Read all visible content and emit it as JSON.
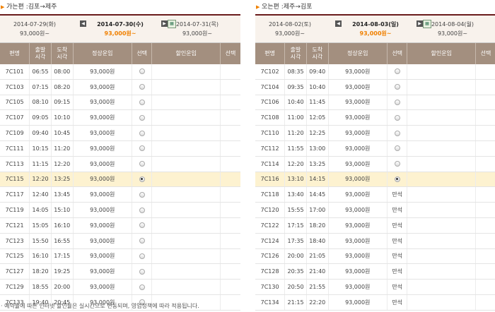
{
  "left": {
    "title": "가는편 :김포→제주",
    "dates": {
      "prev": {
        "date": "2014-07-29(화)",
        "price": "93,000원~"
      },
      "current": {
        "date": "2014-07-30(수)",
        "price": "93,000원~"
      },
      "next": {
        "date": "2014-07-31(목)",
        "price": "93,000원~"
      }
    },
    "headers": [
      "편명",
      "출발\n시각",
      "도착\n시각",
      "정상운임",
      "선택",
      "할인운임",
      "선택"
    ],
    "rows": [
      {
        "flight": "7C101",
        "dep": "06:55",
        "arr": "08:00",
        "fare": "93,000원",
        "status": "radio",
        "selected": false
      },
      {
        "flight": "7C103",
        "dep": "07:15",
        "arr": "08:20",
        "fare": "93,000원",
        "status": "radio",
        "selected": false
      },
      {
        "flight": "7C105",
        "dep": "08:10",
        "arr": "09:15",
        "fare": "93,000원",
        "status": "radio",
        "selected": false
      },
      {
        "flight": "7C107",
        "dep": "09:05",
        "arr": "10:10",
        "fare": "93,000원",
        "status": "radio",
        "selected": false
      },
      {
        "flight": "7C109",
        "dep": "09:40",
        "arr": "10:45",
        "fare": "93,000원",
        "status": "radio",
        "selected": false
      },
      {
        "flight": "7C111",
        "dep": "10:15",
        "arr": "11:20",
        "fare": "93,000원",
        "status": "radio",
        "selected": false
      },
      {
        "flight": "7C113",
        "dep": "11:15",
        "arr": "12:20",
        "fare": "93,000원",
        "status": "radio",
        "selected": false
      },
      {
        "flight": "7C115",
        "dep": "12:20",
        "arr": "13:25",
        "fare": "93,000원",
        "status": "radio",
        "selected": true
      },
      {
        "flight": "7C117",
        "dep": "12:40",
        "arr": "13:45",
        "fare": "93,000원",
        "status": "radio",
        "selected": false
      },
      {
        "flight": "7C119",
        "dep": "14:05",
        "arr": "15:10",
        "fare": "93,000원",
        "status": "radio",
        "selected": false
      },
      {
        "flight": "7C121",
        "dep": "15:05",
        "arr": "16:10",
        "fare": "93,000원",
        "status": "radio",
        "selected": false
      },
      {
        "flight": "7C123",
        "dep": "15:50",
        "arr": "16:55",
        "fare": "93,000원",
        "status": "radio",
        "selected": false
      },
      {
        "flight": "7C125",
        "dep": "16:10",
        "arr": "17:15",
        "fare": "93,000원",
        "status": "radio",
        "selected": false
      },
      {
        "flight": "7C127",
        "dep": "18:20",
        "arr": "19:25",
        "fare": "93,000원",
        "status": "radio",
        "selected": false
      },
      {
        "flight": "7C129",
        "dep": "18:55",
        "arr": "20:00",
        "fare": "93,000원",
        "status": "radio",
        "selected": false
      },
      {
        "flight": "7C133",
        "dep": "19:40",
        "arr": "20:45",
        "fare": "93,000원",
        "status": "radio",
        "selected": false
      }
    ]
  },
  "right": {
    "title": "오는편 :제주→김포",
    "dates": {
      "prev": {
        "date": "2014-08-02(토)",
        "price": "93,000원~"
      },
      "current": {
        "date": "2014-08-03(일)",
        "price": "93,000원~"
      },
      "next": {
        "date": "2014-08-04(월)",
        "price": "93,000원~"
      }
    },
    "headers": [
      "편명",
      "출발\n시각",
      "도착\n시각",
      "정상운임",
      "선택",
      "할인운임",
      "선택"
    ],
    "rows": [
      {
        "flight": "7C102",
        "dep": "08:35",
        "arr": "09:40",
        "fare": "93,000원",
        "status": "radio",
        "selected": false
      },
      {
        "flight": "7C104",
        "dep": "09:35",
        "arr": "10:40",
        "fare": "93,000원",
        "status": "radio",
        "selected": false
      },
      {
        "flight": "7C106",
        "dep": "10:40",
        "arr": "11:45",
        "fare": "93,000원",
        "status": "radio",
        "selected": false
      },
      {
        "flight": "7C108",
        "dep": "11:00",
        "arr": "12:05",
        "fare": "93,000원",
        "status": "radio",
        "selected": false
      },
      {
        "flight": "7C110",
        "dep": "11:20",
        "arr": "12:25",
        "fare": "93,000원",
        "status": "radio",
        "selected": false
      },
      {
        "flight": "7C112",
        "dep": "11:55",
        "arr": "13:00",
        "fare": "93,000원",
        "status": "radio",
        "selected": false
      },
      {
        "flight": "7C114",
        "dep": "12:20",
        "arr": "13:25",
        "fare": "93,000원",
        "status": "radio",
        "selected": false
      },
      {
        "flight": "7C116",
        "dep": "13:10",
        "arr": "14:15",
        "fare": "93,000원",
        "status": "radio",
        "selected": true
      },
      {
        "flight": "7C118",
        "dep": "13:40",
        "arr": "14:45",
        "fare": "93,000원",
        "status": "만석",
        "selected": false
      },
      {
        "flight": "7C120",
        "dep": "15:55",
        "arr": "17:00",
        "fare": "93,000원",
        "status": "만석",
        "selected": false
      },
      {
        "flight": "7C122",
        "dep": "17:15",
        "arr": "18:20",
        "fare": "93,000원",
        "status": "만석",
        "selected": false
      },
      {
        "flight": "7C124",
        "dep": "17:35",
        "arr": "18:40",
        "fare": "93,000원",
        "status": "만석",
        "selected": false
      },
      {
        "flight": "7C126",
        "dep": "20:00",
        "arr": "21:05",
        "fare": "93,000원",
        "status": "만석",
        "selected": false
      },
      {
        "flight": "7C128",
        "dep": "20:35",
        "arr": "21:40",
        "fare": "93,000원",
        "status": "만석",
        "selected": false
      },
      {
        "flight": "7C130",
        "dep": "20:50",
        "arr": "21:55",
        "fare": "93,000원",
        "status": "만석",
        "selected": false
      },
      {
        "flight": "7C134",
        "dep": "21:15",
        "arr": "22:20",
        "fare": "93,000원",
        "status": "만석",
        "selected": false
      }
    ]
  },
  "footnote": "· 예약율에 따른 인터넷 할인율은 실시간으로 변동되며, 영업정책에 따라 적용됩니다.",
  "colors": {
    "header_bg": "#a38f7f",
    "accent": "#f08000",
    "selected_row": "#fdf2d0",
    "datebar_border": "#6a1c1c"
  },
  "icons": {
    "nav_prev": "◀",
    "nav_next": "▶",
    "calendar": "▦",
    "title_arrow": "▶"
  }
}
